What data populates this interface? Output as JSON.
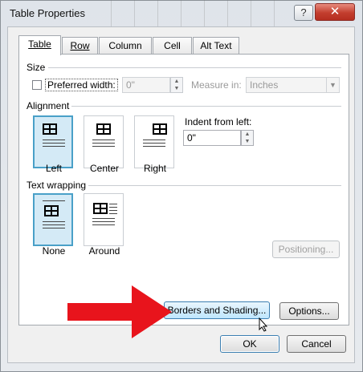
{
  "window": {
    "title": "Table Properties",
    "help_glyph": "?",
    "close_glyph": "✕"
  },
  "tabs": [
    {
      "label": "Table",
      "active": true
    },
    {
      "label": "Row",
      "active": false
    },
    {
      "label": "Column",
      "active": false
    },
    {
      "label": "Cell",
      "active": false
    },
    {
      "label": "Alt Text",
      "active": false
    }
  ],
  "size": {
    "section_label": "Size",
    "preferred_width_label": "Preferred width:",
    "preferred_width_checked": false,
    "preferred_width_value": "0\"",
    "measure_in_label": "Measure in:",
    "measure_in_value": "Inches"
  },
  "alignment": {
    "section_label": "Alignment",
    "options": [
      {
        "label": "Left",
        "selected": true
      },
      {
        "label": "Center",
        "selected": false
      },
      {
        "label": "Right",
        "selected": false
      }
    ],
    "indent_label": "Indent from left:",
    "indent_value": "0\""
  },
  "text_wrapping": {
    "section_label": "Text wrapping",
    "options": [
      {
        "label": "None",
        "selected": true
      },
      {
        "label": "Around",
        "selected": false
      }
    ],
    "positioning_label": "Positioning..."
  },
  "buttons": {
    "borders_shading": "Borders and Shading...",
    "options": "Options...",
    "ok": "OK",
    "cancel": "Cancel"
  },
  "colors": {
    "annotation_arrow": "#e8141c",
    "selected_option_border": "#49a0c8"
  },
  "icons": {
    "up": "▲",
    "down": "▼",
    "dropdown": "▼"
  }
}
